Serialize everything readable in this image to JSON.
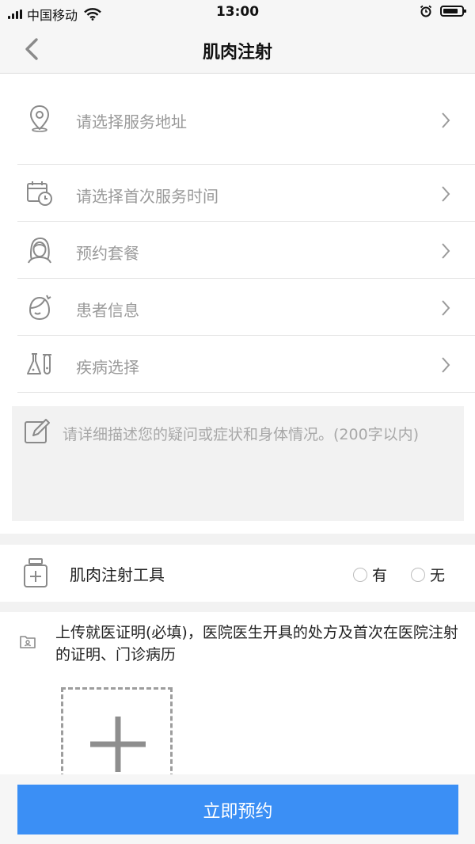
{
  "status_bar": {
    "carrier": "中国移动",
    "time": "13:00"
  },
  "nav": {
    "title": "肌肉注射"
  },
  "rows": [
    {
      "label": "请选择服务地址",
      "icon": "location-icon"
    },
    {
      "label": "请选择首次服务时间",
      "icon": "calendar-clock-icon"
    },
    {
      "label": "预约套餐",
      "icon": "nurse-icon"
    },
    {
      "label": "患者信息",
      "icon": "patient-icon"
    },
    {
      "label": "疾病选择",
      "icon": "lab-flask-icon"
    }
  ],
  "description": {
    "placeholder": "请详细描述您的疑问或症状和身体情况。(200字以内)"
  },
  "tool": {
    "label": "肌肉注射工具",
    "option_yes": "有",
    "option_no": "无"
  },
  "upload": {
    "text": "上传就医证明(必填)，医院医生开具的处方及首次在医院注射的证明、门诊病历"
  },
  "submit": {
    "label": "立即预约"
  },
  "colors": {
    "accent": "#3b8ff5",
    "placeholder": "#9a9a9a",
    "background_gray": "#f2f2f2"
  }
}
